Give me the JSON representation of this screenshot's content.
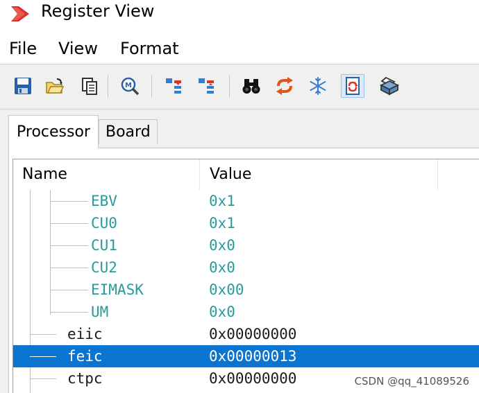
{
  "window": {
    "title": "Register View",
    "app_icon": "red-chevron-logo"
  },
  "menu": {
    "items": [
      "File",
      "View",
      "Format"
    ]
  },
  "toolbar": {
    "buttons": [
      {
        "icon": "save-icon"
      },
      {
        "icon": "open-folder-icon"
      },
      {
        "icon": "copy-icon"
      },
      {
        "icon": "memory-search-icon"
      },
      {
        "icon": "expand-registers-icon"
      },
      {
        "icon": "collapse-registers-icon"
      },
      {
        "icon": "binoculars-icon"
      },
      {
        "icon": "refresh-arrows-icon"
      },
      {
        "icon": "freeze-snowflake-icon"
      },
      {
        "icon": "auto-refresh-icon",
        "active": true
      },
      {
        "icon": "print-icon"
      }
    ]
  },
  "tabs": [
    {
      "label": "Processor",
      "selected": true
    },
    {
      "label": "Board",
      "selected": false
    }
  ],
  "grid": {
    "columns": {
      "name": "Name",
      "value": "Value"
    },
    "rows": [
      {
        "name": "EBV",
        "value": "0x1",
        "level": "child"
      },
      {
        "name": "CU0",
        "value": "0x1",
        "level": "child"
      },
      {
        "name": "CU1",
        "value": "0x0",
        "level": "child"
      },
      {
        "name": "CU2",
        "value": "0x0",
        "level": "child"
      },
      {
        "name": "EIMASK",
        "value": "0x00",
        "level": "child"
      },
      {
        "name": "UM",
        "value": "0x0",
        "level": "child"
      },
      {
        "name": "eiic",
        "value": "0x00000000",
        "level": "parent"
      },
      {
        "name": "feic",
        "value": "0x00000013",
        "level": "parent",
        "selected": true
      },
      {
        "name": "ctpc",
        "value": "0x00000000",
        "level": "parent"
      }
    ]
  },
  "watermark": "CSDN @qq_41089526",
  "colors": {
    "child_text": "#2a9a9a",
    "selection": "#0a74d1",
    "accent_red": "#d9342b"
  }
}
